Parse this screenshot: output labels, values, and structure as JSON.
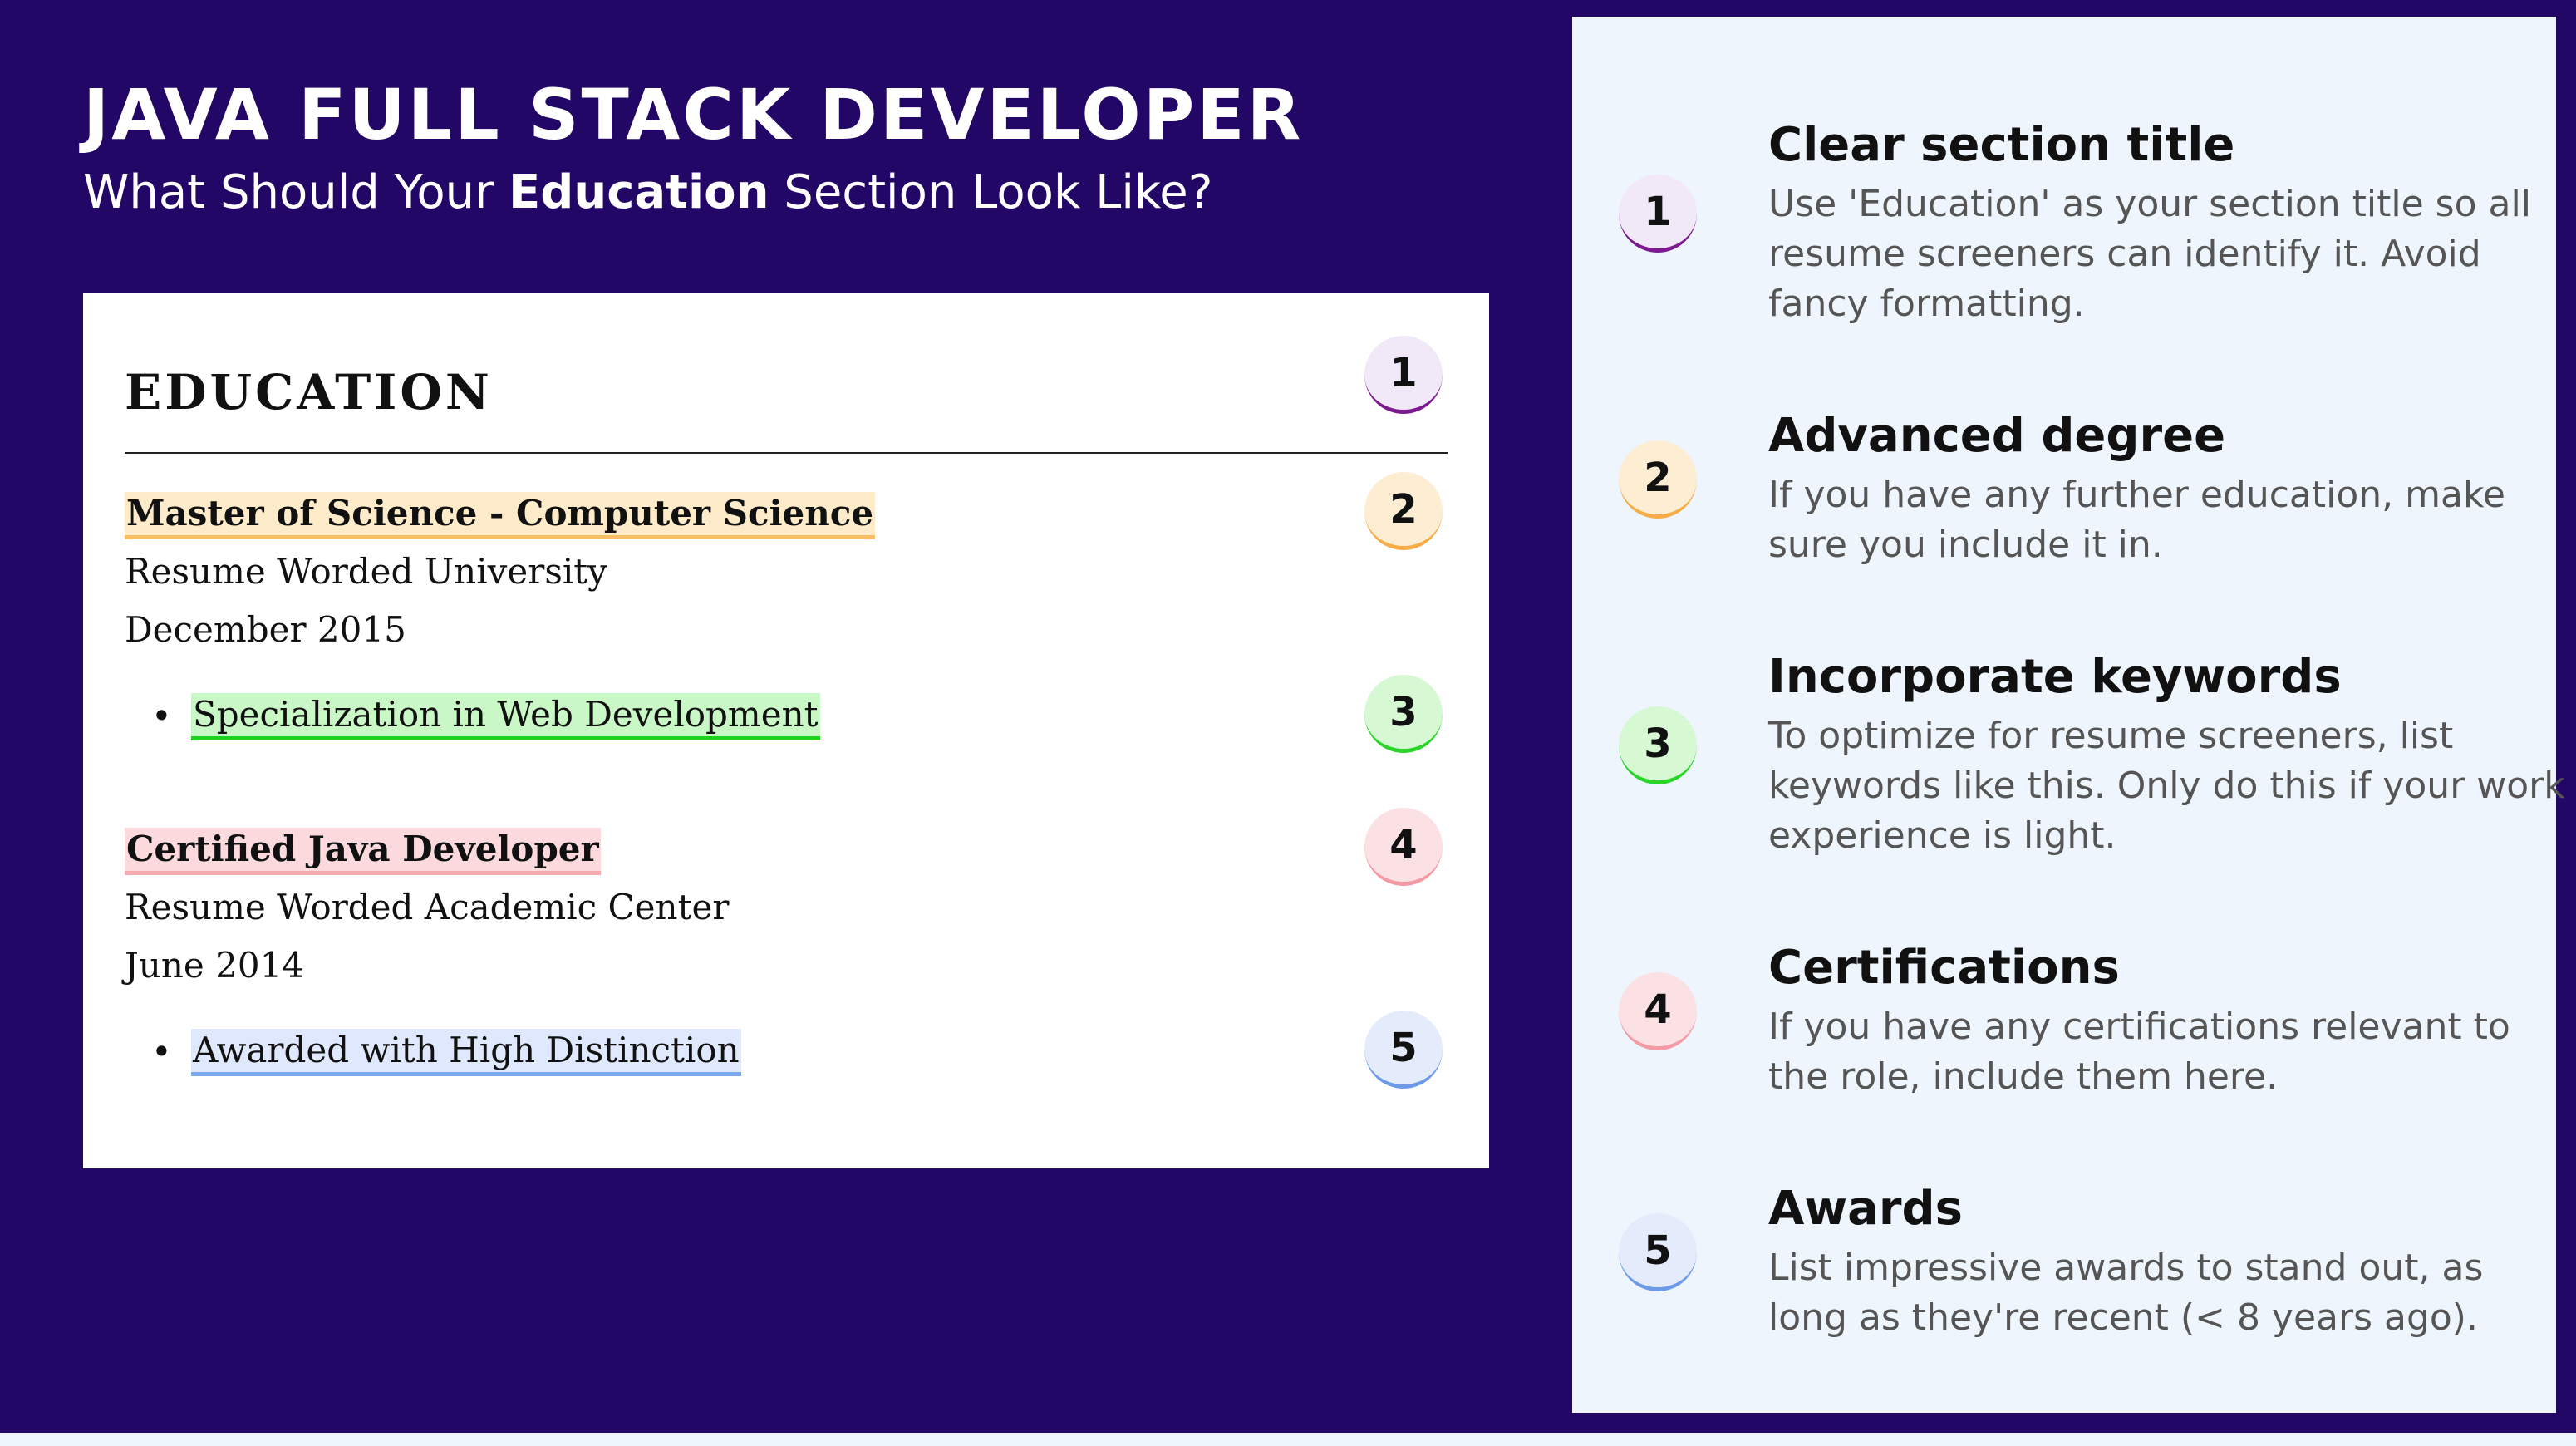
{
  "header": {
    "title": "JAVA FULL STACK DEVELOPER",
    "subtitle_pre": "What Should Your ",
    "subtitle_bold": "Education",
    "subtitle_post": " Section Look Like?"
  },
  "resume": {
    "heading": "EDUCATION",
    "entries": [
      {
        "degree": "Master of Science - Computer Science",
        "institution": "Resume Worded University",
        "date": "December 2015",
        "bullet": "Specialization in Web Development"
      },
      {
        "degree": "Certified Java Developer",
        "institution": "Resume Worded Academic Center",
        "date": "June 2014",
        "bullet": "Awarded with High Distinction"
      }
    ],
    "badges": [
      "1",
      "2",
      "3",
      "4",
      "5"
    ]
  },
  "tips": [
    {
      "number": "1",
      "title": "Clear section title",
      "text": "Use 'Education' as your section title so all resume screeners can identify it. Avoid fancy formatting."
    },
    {
      "number": "2",
      "title": "Advanced degree",
      "text": "If you have any further education, make sure you include it in."
    },
    {
      "number": "3",
      "title": "Incorporate keywords",
      "text": "To optimize for resume screeners, list keywords like this. Only do this if your work experience is light."
    },
    {
      "number": "4",
      "title": "Certifications",
      "text": "If you have any certifications relevant to the role, include them here."
    },
    {
      "number": "5",
      "title": "Awards",
      "text": "List impressive awards to stand out, as long as they're recent (< 8 years ago)."
    }
  ],
  "colors": {
    "background": "#220767",
    "panel": "#eef5fd",
    "badge1": "#7b1a8e",
    "badge2": "#f6ad48",
    "badge3": "#2ad52a",
    "badge4": "#f49aa5",
    "badge5": "#6d9ae8"
  }
}
